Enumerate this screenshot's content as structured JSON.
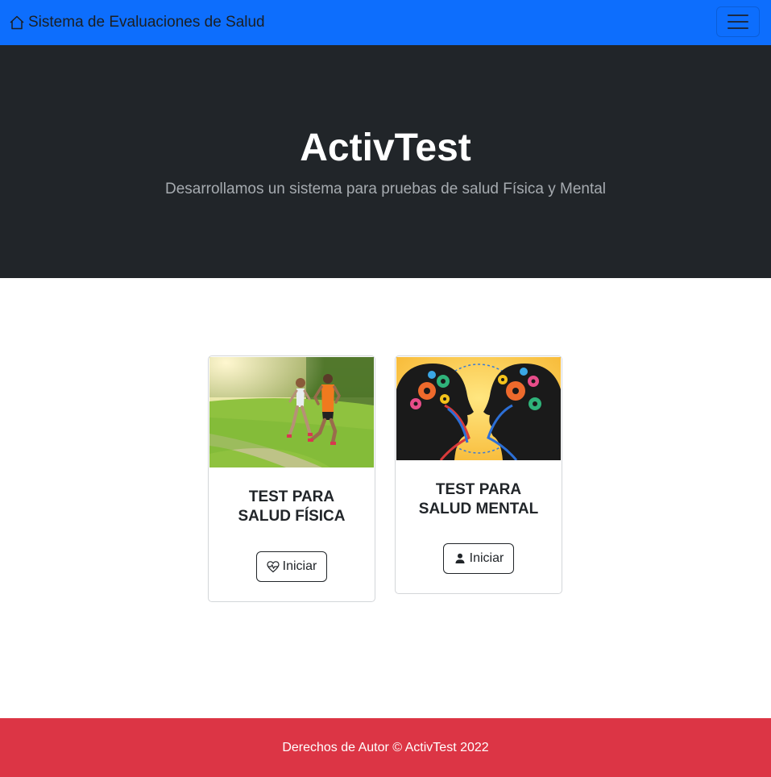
{
  "navbar": {
    "brand": "Sistema de Evaluaciones de Salud",
    "brand_icon": "house-icon",
    "toggler_icon": "hamburger-menu-icon",
    "color": "#0d6efd"
  },
  "hero": {
    "title": "ActivTest",
    "subtitle": "Desarrollamos un sistema para pruebas de salud Física y Mental",
    "background": "#212529"
  },
  "cards": [
    {
      "title_line1": "TEST PARA",
      "title_line2": "SALUD FÍSICA",
      "button_label": "Iniciar",
      "button_icon": "heart-pulse-icon",
      "image": "couple-running-photo"
    },
    {
      "title_line1": "TEST PARA",
      "title_line2": "SALUD MENTAL",
      "button_label": "Iniciar",
      "button_icon": "person-icon",
      "image": "heads-with-gears-illustration"
    }
  ],
  "footer": {
    "text": "Derechos de Autor © ActivTest 2022",
    "background": "#dc3545"
  }
}
